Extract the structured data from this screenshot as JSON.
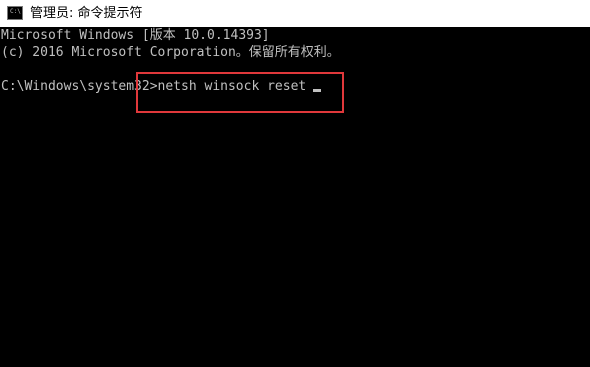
{
  "window": {
    "title": "管理员: 命令提示符",
    "icon": "cmd-icon",
    "icon_glyph": "C:\\"
  },
  "console": {
    "lines": [
      "Microsoft Windows [版本 10.0.14393]",
      "(c) 2016 Microsoft Corporation。保留所有权利。",
      "C:\\Windows\\system32>netsh winsock reset"
    ]
  },
  "colors": {
    "console_bg": "#000000",
    "console_text": "#c0c0c0",
    "titlebar_bg": "#ffffff",
    "highlight": "#e0383b"
  }
}
